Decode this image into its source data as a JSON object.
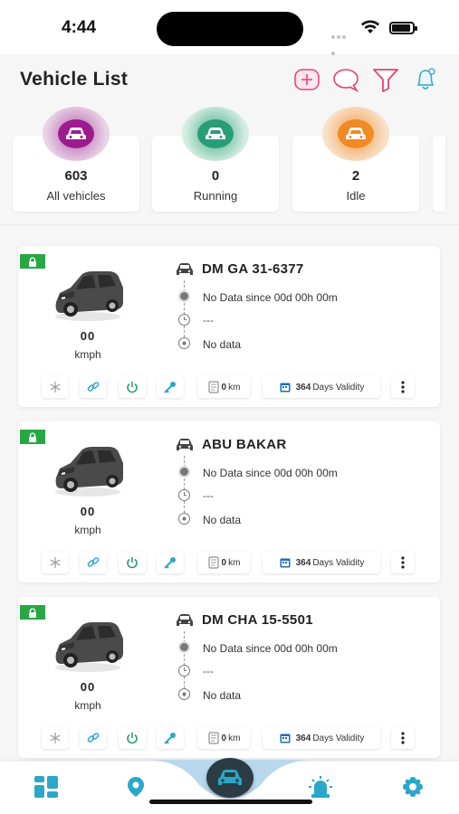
{
  "status": {
    "time": "4:44"
  },
  "header": {
    "title": "Vehicle List"
  },
  "summary": [
    {
      "count": "603",
      "label": "All vehicles",
      "color": "#9c1c8f",
      "ring": "#d9b3d6"
    },
    {
      "count": "0",
      "label": "Running",
      "color": "#2a9d78",
      "ring": "#b3dccc"
    },
    {
      "count": "2",
      "label": "Idle",
      "color": "#f08a24",
      "ring": "#f6d1ac"
    }
  ],
  "vehicles": [
    {
      "name": "DM GA 31-6377",
      "speed": "00",
      "speed_unit": "kmph",
      "status": "No Data since  00d 00h 00m",
      "time": "---",
      "location": "No data",
      "km": "0",
      "km_unit": "km",
      "validity_days": "364",
      "validity_label": "Days Validity"
    },
    {
      "name": "ABU BAKAR",
      "speed": "00",
      "speed_unit": "kmph",
      "status": "No Data since  00d 00h 00m",
      "time": "---",
      "location": "No data",
      "km": "0",
      "km_unit": "km",
      "validity_days": "364",
      "validity_label": "Days Validity"
    },
    {
      "name": "DM CHA 15-5501",
      "speed": "00",
      "speed_unit": "kmph",
      "status": "No Data since  00d 00h 00m",
      "time": "---",
      "location": "No data",
      "km": "0",
      "km_unit": "km",
      "validity_days": "364",
      "validity_label": "Days Validity"
    }
  ],
  "colors": {
    "accent": "#2aa7c9",
    "pink": "#e8407a",
    "lock_green": "#28a745",
    "nav_dark": "#2b3c45"
  },
  "icons": {
    "header": [
      "add-icon",
      "chat-icon",
      "filter-icon",
      "notification-icon"
    ],
    "actions": [
      "snowflake-icon",
      "link-icon",
      "power-icon",
      "key-icon",
      "odometer-icon",
      "calendar-icon",
      "more-vertical-icon"
    ],
    "nav": [
      "dashboard-icon",
      "map-pin-icon",
      "car-icon",
      "alarm-icon",
      "settings-icon"
    ]
  }
}
